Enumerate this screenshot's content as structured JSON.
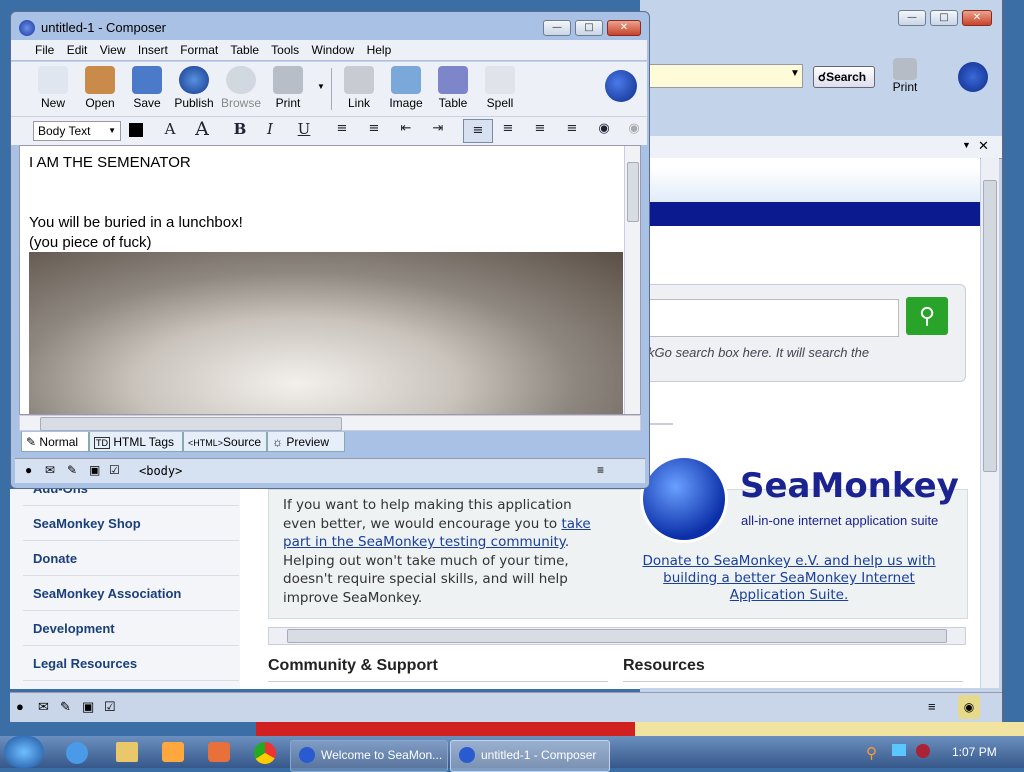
{
  "desktop": {
    "bg": "#3a6ea5"
  },
  "browser": {
    "search_label": "Search",
    "print_label": "Print",
    "search_hint": "kGo search box here. It will search the",
    "nav": [
      "Add-Ons",
      "SeaMonkey Shop",
      "Donate",
      "SeaMonkey Association",
      "Development",
      "Legal Resources"
    ],
    "help_text_1": "If you want to help making this application even better, we would encourage you to ",
    "help_link": "take part in the SeaMonkey testing community",
    "help_text_2": ". Helping out won't take much of your time, doesn't require special skills, and will help improve SeaMonkey.",
    "brand_name": "SeaMonkey",
    "brand_tagline": "all-in-one internet application suite",
    "donate_link": "Donate to SeaMonkey e.V. and help us with building a better SeaMonkey Internet Application Suite.",
    "heading_community": "Community & Support",
    "heading_resources": "Resources"
  },
  "composer": {
    "title": "untitled-1 - Composer",
    "menu": [
      "File",
      "Edit",
      "View",
      "Insert",
      "Format",
      "Table",
      "Tools",
      "Window",
      "Help"
    ],
    "toolbar": [
      "New",
      "Open",
      "Save",
      "Publish",
      "Browse",
      "Print",
      "Link",
      "Image",
      "Table",
      "Spell"
    ],
    "paragraph_style": "Body Text",
    "doc_line1": "I AM THE SEMENATOR",
    "doc_line2": "You will be buried in a lunchbox!",
    "doc_line3": "(you piece of fuck)",
    "tabs": [
      "Normal",
      "HTML Tags",
      "Source",
      "Preview"
    ],
    "tab_icons": [
      "",
      "TD",
      "<HTML>",
      ""
    ],
    "status_tag": "<body>"
  },
  "taskbar": {
    "tasks": [
      "Welcome to SeaMon...",
      "untitled-1 - Composer"
    ],
    "clock": "1:07 PM"
  }
}
